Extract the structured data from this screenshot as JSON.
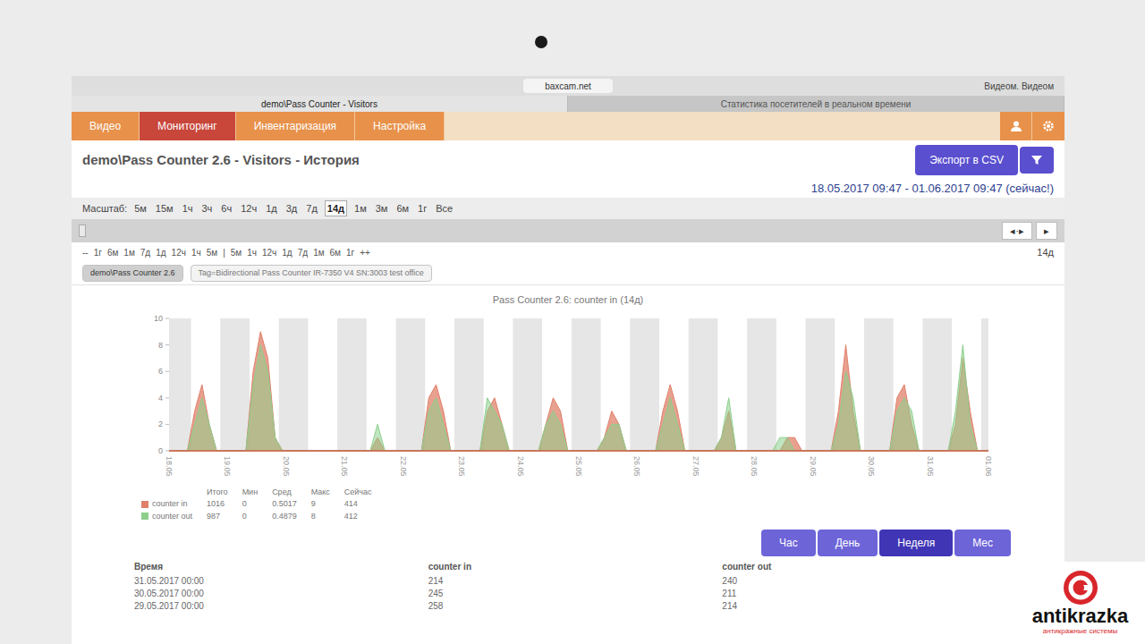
{
  "browser": {
    "url": "baxcam.net",
    "tabs": [
      {
        "label": "demo\\Pass Counter - Visitors",
        "selected": true
      },
      {
        "label": "Статистика посетителей в реальном времени",
        "selected": false
      }
    ],
    "profile": "Видеом. Видеом"
  },
  "nav": {
    "tabs": [
      {
        "label": "Видео",
        "selected": false
      },
      {
        "label": "Мониторинг",
        "selected": true
      },
      {
        "label": "Инвентаризация",
        "selected": false
      },
      {
        "label": "Настройка",
        "selected": false
      }
    ]
  },
  "page": {
    "title": "demo\\Pass Counter 2.6 - Visitors - История",
    "export_button": "Экспорт в CSV",
    "range": "18.05.2017 09:47 - 01.06.2017 09:47 (сейчас!)"
  },
  "scale": {
    "label": "Масштаб:",
    "options": [
      {
        "label": "5м",
        "selected": false
      },
      {
        "label": "15м",
        "selected": false
      },
      {
        "label": "1ч",
        "selected": false
      },
      {
        "label": "3ч",
        "selected": false
      },
      {
        "label": "6ч",
        "selected": false
      },
      {
        "label": "12ч",
        "selected": false
      },
      {
        "label": "1д",
        "selected": false
      },
      {
        "label": "3д",
        "selected": false
      },
      {
        "label": "7д",
        "selected": false
      },
      {
        "label": "14д",
        "selected": true
      },
      {
        "label": "1м",
        "selected": false
      },
      {
        "label": "3м",
        "selected": false
      },
      {
        "label": "6м",
        "selected": false
      },
      {
        "label": "1г",
        "selected": false
      },
      {
        "label": "Все",
        "selected": false
      }
    ]
  },
  "slider": {
    "buttons": [
      "◂·▸",
      "▸"
    ],
    "span": "14д"
  },
  "step_nav": [
    "--",
    "1г",
    "6м",
    "1м",
    "7д",
    "1д",
    "12ч",
    "1ч",
    "5м",
    "|",
    "5м",
    "1ч",
    "12ч",
    "1д",
    "7д",
    "1м",
    "6м",
    "1г",
    "++"
  ],
  "filters": [
    {
      "label": "demo\\Pass Counter 2.6",
      "selected": true
    },
    {
      "label": "Tag=Bidirectional Pass Counter IR-7350 V4 SN:3003 test office",
      "selected": false
    }
  ],
  "chart": {
    "title": "Pass Counter 2.6: counter in (14д)",
    "y_ticks": [
      "10",
      "8",
      "6",
      "4",
      "2",
      "0"
    ],
    "x_labels": [
      "18.05",
      "19.05",
      "20.05",
      "21.05",
      "22.05",
      "23.05",
      "24.05",
      "25.05",
      "26.05",
      "27.05",
      "28.05",
      "29.05",
      "30.05",
      "31.05",
      "01.06"
    ],
    "series": [
      {
        "name": "counter in",
        "color": "#e0806a",
        "values": [
          0,
          0,
          0,
          3,
          5,
          2,
          0,
          0,
          0,
          0,
          0,
          6,
          9,
          7,
          1,
          0,
          0,
          0,
          0,
          0,
          0,
          0,
          0,
          0,
          0,
          0,
          0,
          0,
          1,
          0,
          0,
          0,
          0,
          0,
          0,
          4,
          5,
          3,
          0,
          0,
          0,
          0,
          0,
          3,
          4,
          2,
          0,
          0,
          0,
          0,
          0,
          2,
          4,
          3,
          0,
          0,
          0,
          0,
          0,
          1,
          3,
          2,
          0,
          0,
          0,
          0,
          0,
          3,
          5,
          3,
          0,
          0,
          0,
          0,
          0,
          1,
          3,
          0,
          0,
          0,
          0,
          0,
          0,
          0,
          1,
          1,
          0,
          0,
          0,
          0,
          0,
          3,
          8,
          3,
          0,
          0,
          0,
          0,
          0,
          4,
          5,
          2,
          0,
          0,
          0,
          0,
          0,
          2,
          7,
          3,
          0,
          0
        ]
      },
      {
        "name": "counter out",
        "color": "#8ccf8c",
        "values": [
          0,
          0,
          0,
          2,
          4,
          2,
          0,
          0,
          0,
          0,
          0,
          5,
          8,
          6,
          1,
          0,
          0,
          0,
          0,
          0,
          0,
          0,
          0,
          0,
          0,
          0,
          0,
          0,
          2,
          0,
          0,
          0,
          0,
          0,
          0,
          3,
          4,
          2,
          0,
          0,
          0,
          0,
          0,
          4,
          3,
          2,
          0,
          0,
          0,
          0,
          0,
          2,
          3,
          2,
          0,
          0,
          0,
          0,
          0,
          1,
          2,
          2,
          0,
          0,
          0,
          0,
          0,
          2,
          4,
          2,
          0,
          0,
          0,
          0,
          0,
          1,
          4,
          0,
          0,
          0,
          0,
          0,
          0,
          1,
          1,
          0,
          0,
          0,
          0,
          0,
          0,
          2,
          6,
          4,
          0,
          0,
          0,
          0,
          0,
          3,
          4,
          3,
          0,
          0,
          0,
          0,
          0,
          3,
          8,
          2,
          0,
          0
        ]
      }
    ]
  },
  "stats": {
    "columns": [
      "",
      "Итого",
      "Мин",
      "Сред",
      "Макс",
      "Сейчас"
    ],
    "rows": [
      {
        "name": "counter in",
        "color": "#e0806a",
        "cells": [
          "1016",
          "0",
          "0.5017",
          "9",
          "414"
        ]
      },
      {
        "name": "counter out",
        "color": "#8ccf8c",
        "cells": [
          "987",
          "0",
          "0.4879",
          "8",
          "412"
        ]
      }
    ]
  },
  "periods": [
    {
      "label": "Час",
      "selected": false
    },
    {
      "label": "День",
      "selected": false
    },
    {
      "label": "Неделя",
      "selected": true
    },
    {
      "label": "Мес",
      "selected": false
    }
  ],
  "table": {
    "columns": [
      "Время",
      "counter in",
      "counter out"
    ],
    "rows": [
      [
        "31.05.2017 00:00",
        "214",
        "240"
      ],
      [
        "30.05.2017 00:00",
        "245",
        "211"
      ],
      [
        "29.05.2017 00:00",
        "258",
        "214"
      ]
    ]
  },
  "logo": {
    "name": "antikrazka",
    "tagline": "антикражные системы"
  }
}
